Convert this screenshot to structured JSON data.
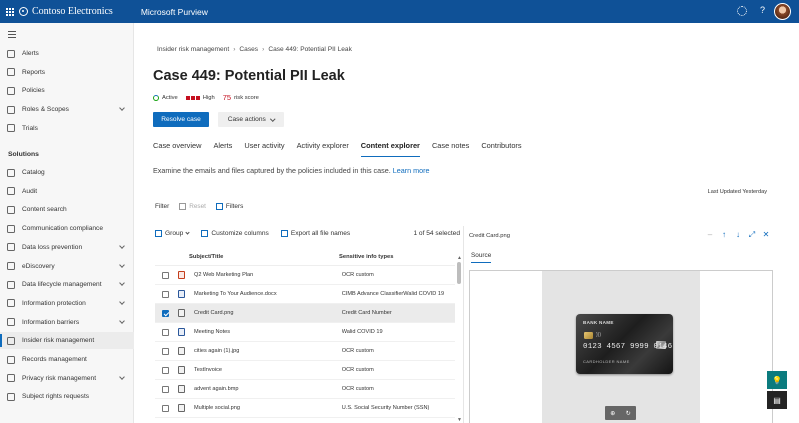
{
  "topbar": {
    "org_name": "Contoso Electronics",
    "app_name": "Microsoft Purview"
  },
  "sidebar": {
    "items_top": [
      {
        "label": "Alerts",
        "icon": "alert-icon"
      },
      {
        "label": "Reports",
        "icon": "reports-icon"
      },
      {
        "label": "Policies",
        "icon": "policies-icon"
      },
      {
        "label": "Roles & Scopes",
        "icon": "roles-icon",
        "expandable": true
      },
      {
        "label": "Trials",
        "icon": "trials-icon"
      }
    ],
    "section_label": "Solutions",
    "items_solutions": [
      {
        "label": "Catalog",
        "icon": "catalog-icon"
      },
      {
        "label": "Audit",
        "icon": "audit-icon"
      },
      {
        "label": "Content search",
        "icon": "search-icon"
      },
      {
        "label": "Communication compliance",
        "icon": "communication-icon"
      },
      {
        "label": "Data loss prevention",
        "icon": "dlp-icon",
        "expandable": true
      },
      {
        "label": "eDiscovery",
        "icon": "ediscovery-icon",
        "expandable": true
      },
      {
        "label": "Data lifecycle management",
        "icon": "lifecycle-icon",
        "expandable": true
      },
      {
        "label": "Information protection",
        "icon": "protection-icon",
        "expandable": true
      },
      {
        "label": "Information barriers",
        "icon": "barriers-icon",
        "expandable": true
      },
      {
        "label": "Insider risk management",
        "icon": "insider-risk-icon",
        "active": true
      },
      {
        "label": "Records management",
        "icon": "records-icon"
      },
      {
        "label": "Privacy risk management",
        "icon": "privacy-icon",
        "expandable": true
      },
      {
        "label": "Subject rights requests",
        "icon": "subject-rights-icon"
      }
    ]
  },
  "breadcrumb": [
    "Insider risk management",
    "Cases",
    "Case 449: Potential PII Leak"
  ],
  "page_title": "Case 449: Potential PII Leak",
  "status": {
    "state": "Active",
    "severity": "High",
    "risk_score": "75",
    "risk_score_label": "risk score",
    "colors": {
      "active": "#13a10e",
      "severity": "#c50f1f"
    }
  },
  "actions": {
    "primary": "Resolve case",
    "secondary": "Case actions"
  },
  "tabs": [
    {
      "label": "Case overview"
    },
    {
      "label": "Alerts"
    },
    {
      "label": "User activity"
    },
    {
      "label": "Activity explorer"
    },
    {
      "label": "Content explorer",
      "active": true
    },
    {
      "label": "Case notes"
    },
    {
      "label": "Contributors"
    }
  ],
  "description": "Examine the emails and files captured by the policies included in this case.",
  "learn_more": "Learn more",
  "last_updated": "Last Updated Yesterday",
  "filter_bar": {
    "filter_label": "Filter",
    "reset_label": "Reset",
    "filters_label": "Filters"
  },
  "list_toolbar": {
    "group": "Group",
    "customize": "Customize columns",
    "export": "Export all file names",
    "selection_count": "1 of 54 selected"
  },
  "table": {
    "columns": [
      "Subject/Title",
      "Sensitive info types"
    ],
    "rows": [
      {
        "title": "Q2 Web Marketing Plan",
        "info": "OCR custom",
        "type": "ppt",
        "selected": false
      },
      {
        "title": "Marketing To Your Audience.docx",
        "info": "CIMB Advance ClassifierWalid COVID 19",
        "type": "word",
        "selected": false
      },
      {
        "title": "Credit Card.png",
        "info": "Credit Card Number",
        "type": "img",
        "selected": true
      },
      {
        "title": "Meeting Notes",
        "info": "Walid COVID 19",
        "type": "word",
        "selected": false
      },
      {
        "title": "cities again (1).jpg",
        "info": "OCR custom",
        "type": "img",
        "selected": false
      },
      {
        "title": "TestInvoice",
        "info": "OCR custom",
        "type": "img",
        "selected": false
      },
      {
        "title": "advent again.bmp",
        "info": "OCR custom",
        "type": "img",
        "selected": false
      },
      {
        "title": "Multiple social.png",
        "info": "U.S. Social Security Number (SSN)",
        "type": "img",
        "selected": false
      }
    ]
  },
  "preview": {
    "file_name": "Credit Card.png",
    "tab": "Source",
    "card": {
      "bank_name": "BANK NAME",
      "number": "0123 4567 9999 0146",
      "holder": "CARDHOLDER NAME"
    }
  }
}
